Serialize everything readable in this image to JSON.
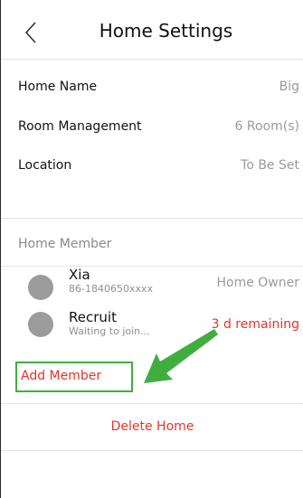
{
  "header": {
    "title": "Home Settings",
    "back_icon": "chevron-left-icon"
  },
  "settings": [
    {
      "label": "Home Name",
      "value": "Big"
    },
    {
      "label": "Room Management",
      "value": "6 Room(s)"
    },
    {
      "label": "Location",
      "value": "To Be Set"
    }
  ],
  "members_section": {
    "title": "Home Member",
    "members": [
      {
        "name": "Xia",
        "sub": "86-1840650xxxx",
        "role": "Home Owner"
      },
      {
        "name": "Recruit",
        "sub": "Waiting to join...",
        "role": "3 d remaining"
      }
    ],
    "add_member_label": "Add Member"
  },
  "delete_home_label": "Delete Home",
  "colors": {
    "accent_red": "#e4342b",
    "highlight_green": "#3fae3f",
    "muted_gray": "#9a9a9a",
    "avatar_gray": "#9b9b9b"
  }
}
